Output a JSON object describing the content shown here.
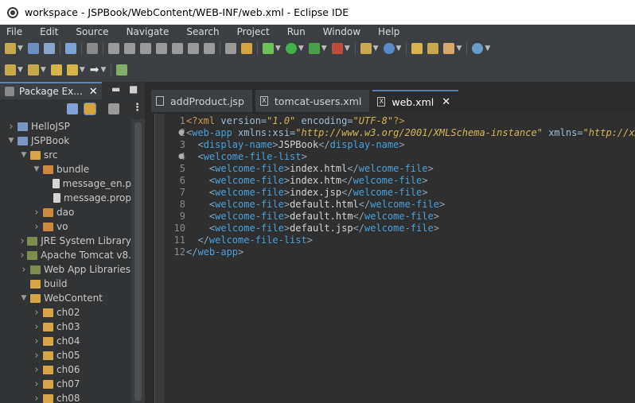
{
  "window": {
    "title": "workspace - JSPBook/WebContent/WEB-INF/web.xml - Eclipse IDE"
  },
  "menu": [
    "File",
    "Edit",
    "Source",
    "Navigate",
    "Search",
    "Project",
    "Run",
    "Window",
    "Help"
  ],
  "package_explorer": {
    "tab_label": "Package Ex...",
    "tree": [
      {
        "label": "HelloJSP",
        "depth": 0,
        "arrow": "right",
        "icon": "project-icon"
      },
      {
        "label": "JSPBook",
        "depth": 0,
        "arrow": "down",
        "icon": "project-icon"
      },
      {
        "label": "src",
        "depth": 1,
        "arrow": "down",
        "icon": "folder-icon"
      },
      {
        "label": "bundle",
        "depth": 2,
        "arrow": "down",
        "icon": "package-icon"
      },
      {
        "label": "message_en.p",
        "depth": 3,
        "arrow": "",
        "icon": "file-icon"
      },
      {
        "label": "message.prop",
        "depth": 3,
        "arrow": "",
        "icon": "file-icon"
      },
      {
        "label": "dao",
        "depth": 2,
        "arrow": "right",
        "icon": "package-icon"
      },
      {
        "label": "vo",
        "depth": 2,
        "arrow": "right",
        "icon": "package-icon"
      },
      {
        "label": "JRE System Library",
        "depth": 1,
        "arrow": "right",
        "icon": "library-icon"
      },
      {
        "label": "Apache Tomcat v8.",
        "depth": 1,
        "arrow": "right",
        "icon": "library-icon"
      },
      {
        "label": "Web App Libraries",
        "depth": 1,
        "arrow": "right",
        "icon": "library-icon"
      },
      {
        "label": "build",
        "depth": 1,
        "arrow": "",
        "icon": "folder-icon"
      },
      {
        "label": "WebContent",
        "depth": 1,
        "arrow": "down",
        "icon": "folder-icon"
      },
      {
        "label": "ch02",
        "depth": 2,
        "arrow": "right",
        "icon": "folder-icon"
      },
      {
        "label": "ch03",
        "depth": 2,
        "arrow": "right",
        "icon": "folder-icon"
      },
      {
        "label": "ch04",
        "depth": 2,
        "arrow": "right",
        "icon": "folder-icon"
      },
      {
        "label": "ch05",
        "depth": 2,
        "arrow": "right",
        "icon": "folder-icon"
      },
      {
        "label": "ch06",
        "depth": 2,
        "arrow": "right",
        "icon": "folder-icon"
      },
      {
        "label": "ch07",
        "depth": 2,
        "arrow": "right",
        "icon": "folder-icon"
      },
      {
        "label": "ch08",
        "depth": 2,
        "arrow": "right",
        "icon": "folder-icon"
      }
    ]
  },
  "editor": {
    "tabs": [
      {
        "label": "addProduct.jsp",
        "icon": "jsp-file-icon",
        "active": false
      },
      {
        "label": "tomcat-users.xml",
        "icon": "xml-file-icon",
        "active": false
      },
      {
        "label": "web.xml",
        "icon": "xml-file-icon",
        "active": true
      }
    ],
    "lines": [
      {
        "n": "1",
        "fold": false,
        "tokens": [
          [
            "pi",
            "<?"
          ],
          [
            "pi",
            "xml "
          ],
          [
            "attr",
            "version="
          ],
          [
            "val",
            "\"1.0\""
          ],
          [
            "text",
            " "
          ],
          [
            "attr",
            "encoding="
          ],
          [
            "val",
            "\"UTF-8\""
          ],
          [
            "pi",
            "?>"
          ]
        ]
      },
      {
        "n": "2",
        "fold": true,
        "tokens": [
          [
            "ang",
            "<"
          ],
          [
            "tag",
            "web-app "
          ],
          [
            "attr",
            "xmlns:xsi="
          ],
          [
            "val",
            "\"http://www.w3.org/2001/XMLSchema-instance\""
          ],
          [
            "text",
            " "
          ],
          [
            "attr",
            "xmlns="
          ],
          [
            "val",
            "\"http://xmlr"
          ]
        ]
      },
      {
        "n": "3",
        "fold": false,
        "tokens": [
          [
            "text",
            "  "
          ],
          [
            "ang",
            "<"
          ],
          [
            "tag",
            "display-name"
          ],
          [
            "ang",
            ">"
          ],
          [
            "text",
            "JSPBook"
          ],
          [
            "ang",
            "</"
          ],
          [
            "tag",
            "display-name"
          ],
          [
            "ang",
            ">"
          ]
        ]
      },
      {
        "n": "4",
        "fold": true,
        "tokens": [
          [
            "text",
            "  "
          ],
          [
            "ang",
            "<"
          ],
          [
            "tag",
            "welcome-file-list"
          ],
          [
            "ang",
            ">"
          ]
        ]
      },
      {
        "n": "5",
        "fold": false,
        "tokens": [
          [
            "text",
            "    "
          ],
          [
            "ang",
            "<"
          ],
          [
            "tag",
            "welcome-file"
          ],
          [
            "ang",
            ">"
          ],
          [
            "text",
            "index.html"
          ],
          [
            "ang",
            "</"
          ],
          [
            "tag",
            "welcome-file"
          ],
          [
            "ang",
            ">"
          ]
        ]
      },
      {
        "n": "6",
        "fold": false,
        "tokens": [
          [
            "text",
            "    "
          ],
          [
            "ang",
            "<"
          ],
          [
            "tag",
            "welcome-file"
          ],
          [
            "ang",
            ">"
          ],
          [
            "text",
            "index.htm"
          ],
          [
            "ang",
            "</"
          ],
          [
            "tag",
            "welcome-file"
          ],
          [
            "ang",
            ">"
          ]
        ]
      },
      {
        "n": "7",
        "fold": false,
        "tokens": [
          [
            "text",
            "    "
          ],
          [
            "ang",
            "<"
          ],
          [
            "tag",
            "welcome-file"
          ],
          [
            "ang",
            ">"
          ],
          [
            "text",
            "index.jsp"
          ],
          [
            "ang",
            "</"
          ],
          [
            "tag",
            "welcome-file"
          ],
          [
            "ang",
            ">"
          ]
        ]
      },
      {
        "n": "8",
        "fold": false,
        "tokens": [
          [
            "text",
            "    "
          ],
          [
            "ang",
            "<"
          ],
          [
            "tag",
            "welcome-file"
          ],
          [
            "ang",
            ">"
          ],
          [
            "text",
            "default.html"
          ],
          [
            "ang",
            "</"
          ],
          [
            "tag",
            "welcome-file"
          ],
          [
            "ang",
            ">"
          ]
        ]
      },
      {
        "n": "9",
        "fold": false,
        "tokens": [
          [
            "text",
            "    "
          ],
          [
            "ang",
            "<"
          ],
          [
            "tag",
            "welcome-file"
          ],
          [
            "ang",
            ">"
          ],
          [
            "text",
            "default.htm"
          ],
          [
            "ang",
            "</"
          ],
          [
            "tag",
            "welcome-file"
          ],
          [
            "ang",
            ">"
          ]
        ]
      },
      {
        "n": "10",
        "fold": false,
        "tokens": [
          [
            "text",
            "    "
          ],
          [
            "ang",
            "<"
          ],
          [
            "tag",
            "welcome-file"
          ],
          [
            "ang",
            ">"
          ],
          [
            "text",
            "default.jsp"
          ],
          [
            "ang",
            "</"
          ],
          [
            "tag",
            "welcome-file"
          ],
          [
            "ang",
            ">"
          ]
        ]
      },
      {
        "n": "11",
        "fold": false,
        "tokens": [
          [
            "text",
            "  "
          ],
          [
            "ang",
            "</"
          ],
          [
            "tag",
            "welcome-file-list"
          ],
          [
            "ang",
            ">"
          ]
        ]
      },
      {
        "n": "12",
        "fold": false,
        "tokens": [
          [
            "ang",
            "</"
          ],
          [
            "tag",
            "web-app"
          ],
          [
            "ang",
            ">"
          ]
        ]
      }
    ]
  }
}
